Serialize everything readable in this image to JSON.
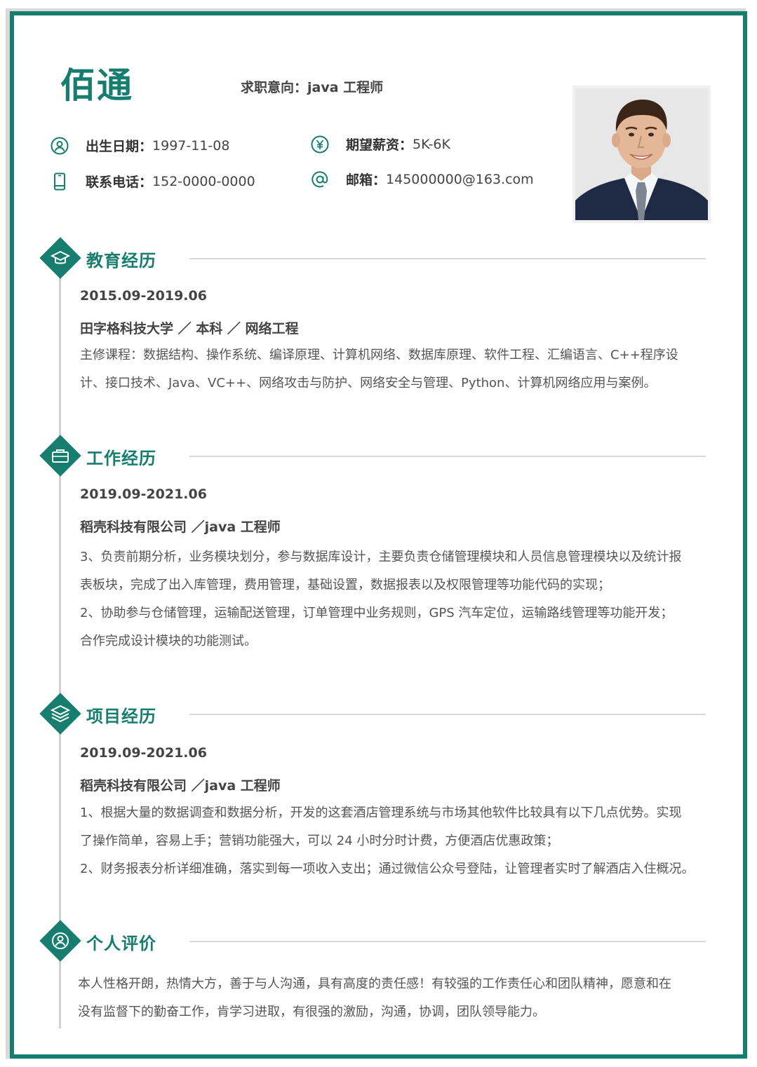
{
  "header": {
    "name": "佰通",
    "intent_label": "求职意向：",
    "intent_value": "java 工程师"
  },
  "info": {
    "birth_label": "出生日期：",
    "birth_value": "1997-11-08",
    "phone_label": "联系电话：",
    "phone_value": "152-0000-0000",
    "salary_label": "期望薪资：",
    "salary_value": "5K-6K",
    "email_label": "邮箱：",
    "email_value": "145000000@163.com"
  },
  "education": {
    "title": "教育经历",
    "date": "2015.09-2019.06",
    "org": "田字格科技大学 ／ 本科 ／ 网络工程",
    "lines": [
      "主修课程：数据结构、操作系统、编译原理、计算机网络、数据库原理、软件工程、汇编语言、C++程序设",
      "计、接口技术、Java、VC++、网络攻击与防护、网络安全与管理、Python、计算机网络应用与案例。"
    ]
  },
  "work": {
    "title": "工作经历",
    "date": "2019.09-2021.06",
    "org": "稻壳科技有限公司 ／java 工程师",
    "lines": [
      "3、负责前期分析，业务模块划分，参与数据库设计，主要负责仓储管理模块和人员信息管理模块以及统计报",
      "表板块，完成了出入库管理，费用管理，基础设置，数据报表以及权限管理等功能代码的实现；",
      "2、协助参与仓储管理，运输配送管理，订单管理中业务规则，GPS 汽车定位，运输路线管理等功能开发；",
      "合作完成设计模块的功能测试。"
    ]
  },
  "project": {
    "title": "项目经历",
    "date": "2019.09-2021.06",
    "org": "稻壳科技有限公司 ／java 工程师",
    "lines": [
      "1、根据大量的数据调查和数据分析，开发的这套酒店管理系统与市场其他软件比较具有以下几点优势。实现",
      "了操作简单，容易上手；营销功能强大，可以 24 小时分时计费，方便酒店优惠政策；",
      "2、财务报表分析详细准确，落实到每一项收入支出；通过微信公众号登陆，让管理者实时了解酒店入住概况。"
    ]
  },
  "evaluation": {
    "title": "个人评价",
    "lines": [
      "本人性格开朗，热情大方，善于与人沟通，具有高度的责任感！有较强的工作责任心和团队精神，愿意和在",
      "没有监督下的勤奋工作，肯学习进取，有很强的激励，沟通，协调，团队领导能力。"
    ]
  },
  "colors": {
    "accent": "#177e6f",
    "frame_gray": "#d9d9d9"
  },
  "icons": {
    "birth": "user-circle-icon",
    "phone": "mobile-phone-icon",
    "salary": "yen-circle-icon",
    "email": "at-sign-icon",
    "education": "graduation-cap-icon",
    "work": "briefcase-icon",
    "project": "layers-icon",
    "evaluation": "person-icon"
  }
}
